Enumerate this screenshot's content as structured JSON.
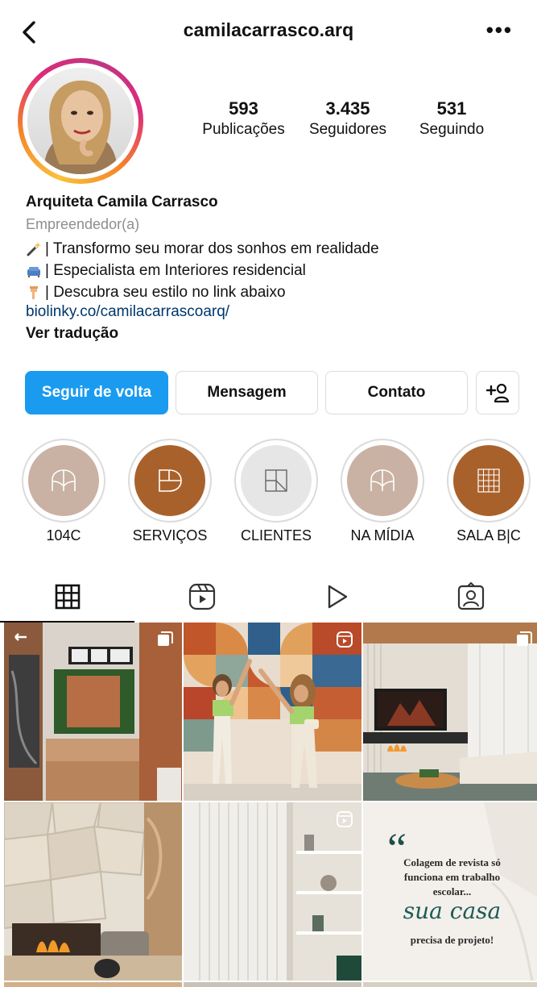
{
  "header": {
    "username": "camilacarrasco.arq",
    "more_label": "•••"
  },
  "profile": {
    "stats": [
      {
        "value": "593",
        "label": "Publicações"
      },
      {
        "value": "3.435",
        "label": "Seguidores"
      },
      {
        "value": "531",
        "label": "Seguindo"
      }
    ],
    "name": "Arquiteta Camila Carrasco",
    "category": "Empreendedor(a)",
    "bio_lines": [
      "| Transformo seu morar dos sonhos em realidade",
      "| Especialista em Interiores residencial",
      "| Descubra seu estilo no link abaixo"
    ],
    "link": "biolinky.co/camilacarrascoarq/",
    "translate": "Ver tradução"
  },
  "actions": {
    "follow_back": "Seguir de volta",
    "message": "Mensagem",
    "contact": "Contato"
  },
  "highlights": [
    {
      "label": "104C",
      "color": "#c9b2a4"
    },
    {
      "label": "SERVIÇOS",
      "color": "#a9612b"
    },
    {
      "label": "CLIENTES",
      "color": "#e6e6e6"
    },
    {
      "label": "NA MÍDIA",
      "color": "#c9b2a4"
    },
    {
      "label": "SALA B|C",
      "color": "#a9612b"
    }
  ],
  "tabs": [
    "grid",
    "reels",
    "videos",
    "tagged"
  ],
  "posts": [
    {
      "type": "carousel"
    },
    {
      "type": "reel"
    },
    {
      "type": "carousel"
    },
    {
      "type": "image"
    },
    {
      "type": "reel"
    },
    {
      "type": "image",
      "text": {
        "line1": "Colagem de revista só",
        "line2": "funciona em trabalho",
        "line3": "escolar...",
        "script": "sua casa",
        "line4": "precisa de projeto!"
      }
    }
  ],
  "colors": {
    "accent": "#1a9bf0",
    "link": "#00376b",
    "muted": "#8e8e8e"
  }
}
